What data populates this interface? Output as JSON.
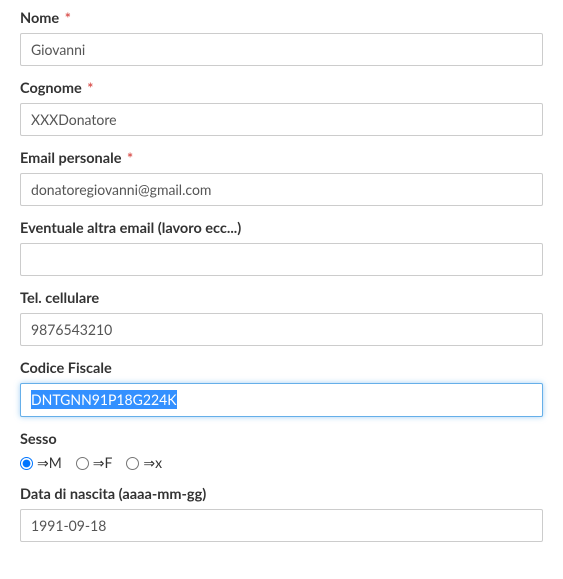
{
  "fields": {
    "nome": {
      "label": "Nome",
      "required": true,
      "value": "Giovanni"
    },
    "cognome": {
      "label": "Cognome",
      "required": true,
      "value": "XXXDonatore"
    },
    "email": {
      "label": "Email personale",
      "required": true,
      "value": "donatoregiovanni@gmail.com"
    },
    "altra_email": {
      "label": "Eventuale altra email (lavoro ecc...)",
      "required": false,
      "value": ""
    },
    "tel": {
      "label": "Tel. cellulare",
      "required": false,
      "value": "9876543210"
    },
    "cf": {
      "label": "Codice Fiscale",
      "required": false,
      "value": "DNTGNN91P18G224K"
    },
    "sesso": {
      "label": "Sesso"
    },
    "dob": {
      "label": "Data di nascita (aaaa-mm-gg)",
      "value": "1991-09-18"
    }
  },
  "sesso_options": {
    "m": "⇒M",
    "f": "⇒F",
    "x": "⇒x"
  },
  "required_marker": "*"
}
